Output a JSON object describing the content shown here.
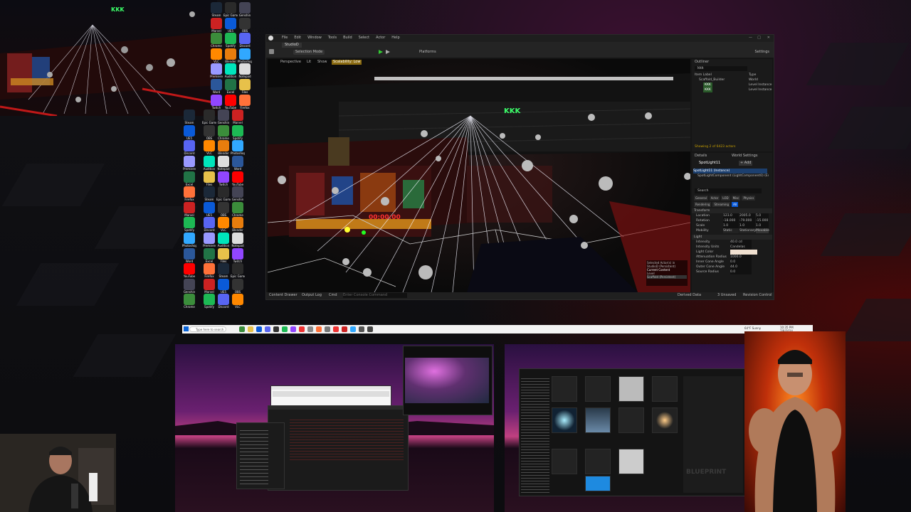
{
  "game_preview": {
    "sign": "KKK"
  },
  "desktop_icons": [
    {
      "label": "Steam",
      "color": "#1b2838"
    },
    {
      "label": "Epic Games",
      "color": "#2a2a2a"
    },
    {
      "label": "Genshin",
      "color": "#445"
    },
    {
      "label": "Marvel",
      "color": "#c22"
    },
    {
      "label": "UE5",
      "color": "#0a5ad8"
    },
    {
      "label": "OBS",
      "color": "#333"
    },
    {
      "label": "Chrome",
      "color": "#3b8d3b"
    },
    {
      "label": "Spotify",
      "color": "#1db954"
    },
    {
      "label": "Discord",
      "color": "#5865f2"
    },
    {
      "label": "VLC",
      "color": "#f80"
    },
    {
      "label": "Blender",
      "color": "#e87d0d"
    },
    {
      "label": "Photoshop",
      "color": "#31a8ff"
    },
    {
      "label": "Premiere",
      "color": "#9999ff"
    },
    {
      "label": "Audition",
      "color": "#00e4bb"
    },
    {
      "label": "Notepad",
      "color": "#ddd"
    },
    {
      "label": "Word",
      "color": "#2b579a"
    },
    {
      "label": "Excel",
      "color": "#217346"
    },
    {
      "label": "Files",
      "color": "#e7c14a"
    },
    {
      "label": "Twitch",
      "color": "#9146ff"
    },
    {
      "label": "YouTube",
      "color": "#f00"
    },
    {
      "label": "Firefox",
      "color": "#ff7139"
    }
  ],
  "ue": {
    "menus": [
      "File",
      "Edit",
      "Window",
      "Tools",
      "Build",
      "Select",
      "Actor",
      "Help"
    ],
    "project": "StudioD",
    "mode": "Selection Mode",
    "platforms": "Platforms",
    "settings": "Settings",
    "viewport": {
      "perspective": "Perspective",
      "lit": "Lit",
      "show": "Show",
      "scalability": "Scalability: Low",
      "sign": "KKK",
      "score": "00:00:00"
    },
    "outliner": {
      "title": "Outliner",
      "search": "kkk",
      "col_label": "Item Label",
      "col_type": "Type",
      "items": [
        {
          "label": "Item Label",
          "type": "Type"
        },
        {
          "label": "Scaffold_Builder",
          "type": "World"
        },
        {
          "label": "KKK",
          "type": "Level Instance"
        },
        {
          "label": "KKK",
          "type": "Level Instance"
        }
      ],
      "footer": "Showing 2 of 6423 actors"
    },
    "details": {
      "tab1": "Details",
      "tab2": "World Settings",
      "actor": "SpotLight11",
      "add": "+ Add",
      "component": "SpotLight11 (Instance)",
      "subcomponent": "SpotLightComponent (LightComponent0) (Edit",
      "search": "Search",
      "filter_tabs": [
        "General",
        "Actor",
        "LOD",
        "Misc",
        "Physics",
        "Rendering",
        "Streaming",
        "All"
      ],
      "sections": [
        {
          "name": "Transform",
          "props": [
            {
              "label": "Location",
              "values": [
                "123.0",
                "2005.0",
                "5.0"
              ]
            },
            {
              "label": "Rotation",
              "values": [
                "-18.000",
                "-79.000",
                "-15.000"
              ]
            },
            {
              "label": "Scale",
              "values": [
                "1.0",
                "1.0",
                "1.0"
              ]
            },
            {
              "label": "Mobility",
              "values": [
                "Static",
                "Stationary",
                "Movable"
              ]
            }
          ]
        },
        {
          "name": "Light",
          "props": [
            {
              "label": "Intensity",
              "values": [
                "40.0 cd"
              ]
            },
            {
              "label": "Intensity Units",
              "values": [
                "Candelas"
              ]
            },
            {
              "label": "Light Color",
              "values": [
                ""
              ]
            },
            {
              "label": "Attenuation Radius",
              "values": [
                "1000.0"
              ]
            },
            {
              "label": "Inner Cone Angle",
              "values": [
                "0.0"
              ]
            },
            {
              "label": "Outer Cone Angle",
              "values": [
                "44.0"
              ]
            },
            {
              "label": "Source Radius",
              "values": [
                "0.0"
              ]
            }
          ]
        }
      ]
    },
    "selection_popup": {
      "line1": "Selected Actor(s) in",
      "line2": "StudioD (Persistent)",
      "line3": "Current Content",
      "line4": "Level",
      "line5": "Scaffold (Persistent)"
    },
    "bottom": {
      "content_drawer": "Content Drawer",
      "output_log": "Output Log",
      "cmd": "Cmd",
      "cmd_placeholder": "Enter Console Command",
      "derived": "Derived Data",
      "unsaved": "3 Unsaved",
      "revision": "Revision Control"
    }
  },
  "taskbar": {
    "search_placeholder": "Type here to search",
    "weather": "64°F Sunny",
    "time": "10:35 PM",
    "date": "7/8/2024"
  },
  "screen3": {
    "blueprint_text": "BLUEPRINT"
  }
}
